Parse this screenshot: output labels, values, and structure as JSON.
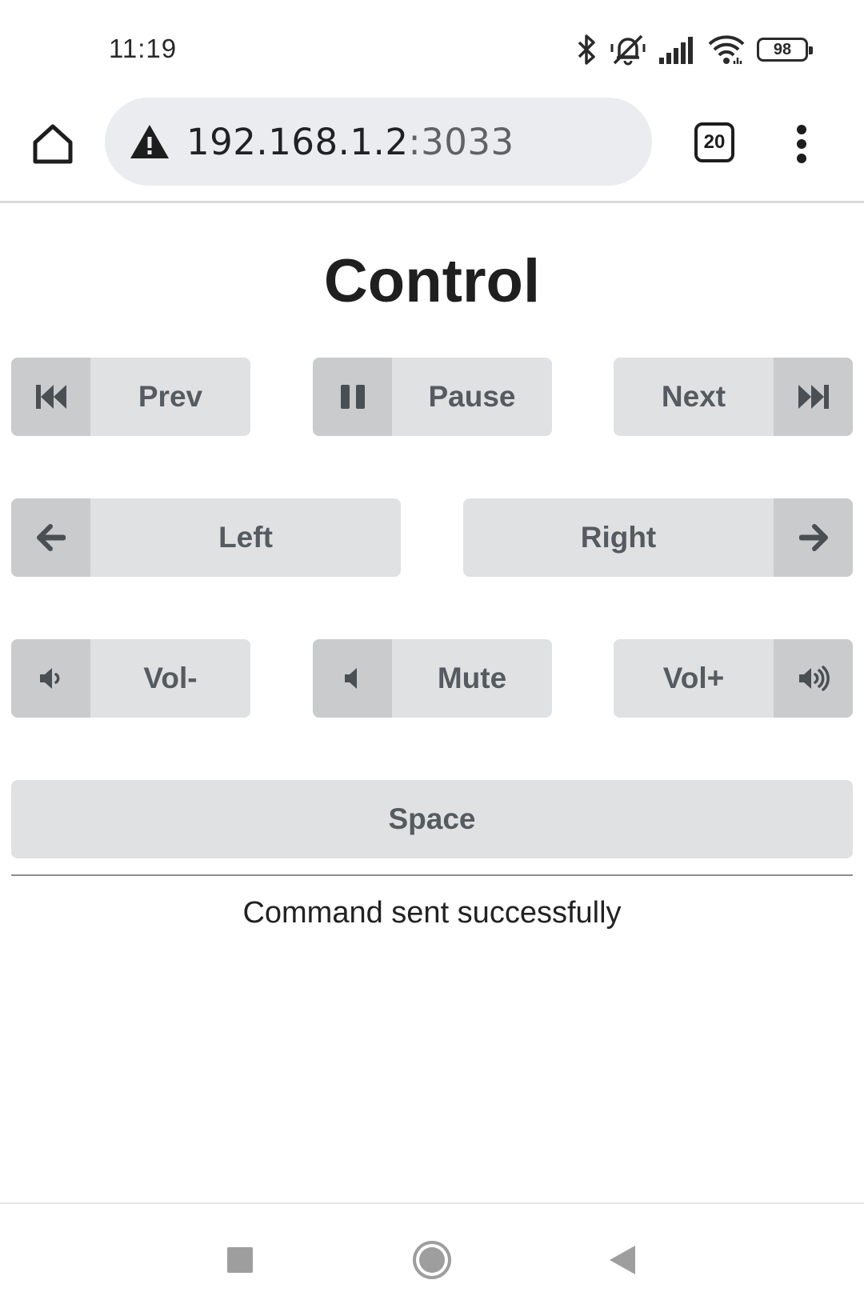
{
  "status_bar": {
    "time": "11:19",
    "battery_level": "98",
    "icons": [
      "bluetooth-icon",
      "muted-bell-icon",
      "signal-icon",
      "wifi-icon",
      "battery-icon"
    ]
  },
  "browser": {
    "url_host": "192.168.1.2",
    "url_port": ":3033",
    "tab_count": "20",
    "icons": [
      "home-icon",
      "warning-icon",
      "more-vert-icon"
    ]
  },
  "page": {
    "title": "Control",
    "buttons": {
      "prev": "Prev",
      "pause": "Pause",
      "next": "Next",
      "left": "Left",
      "right": "Right",
      "vol_down": "Vol-",
      "mute": "Mute",
      "vol_up": "Vol+",
      "space": "Space"
    },
    "status_message": "Command sent successfully"
  },
  "colors": {
    "button_bg": "#e0e1e2",
    "button_icon_bg": "#cacbcd",
    "button_text": "#555b60",
    "url_bar_bg": "#ebecef"
  }
}
